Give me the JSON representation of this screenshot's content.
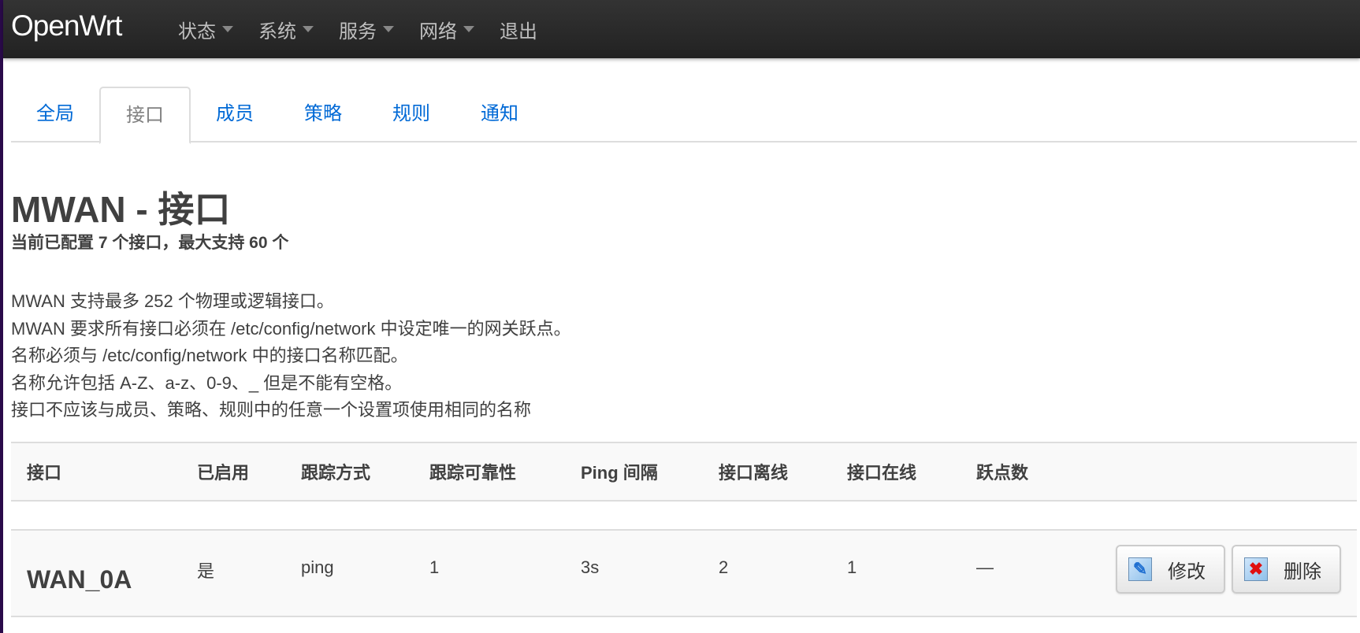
{
  "navbar": {
    "brand": "OpenWrt",
    "items": [
      {
        "label": "状态",
        "dropdown": true
      },
      {
        "label": "系统",
        "dropdown": true
      },
      {
        "label": "服务",
        "dropdown": true
      },
      {
        "label": "网络",
        "dropdown": true
      },
      {
        "label": "退出",
        "dropdown": false
      }
    ]
  },
  "tabs": [
    {
      "label": "全局"
    },
    {
      "label": "接口",
      "active": true
    },
    {
      "label": "成员"
    },
    {
      "label": "策略"
    },
    {
      "label": "规则"
    },
    {
      "label": "通知"
    }
  ],
  "page": {
    "title": "MWAN - 接口",
    "subtitle": "当前已配置 7 个接口，最大支持 60 个",
    "description": [
      "MWAN 支持最多 252 个物理或逻辑接口。",
      "MWAN 要求所有接口必须在 /etc/config/network 中设定唯一的网关跃点。",
      "名称必须与 /etc/config/network 中的接口名称匹配。",
      "名称允许包括 A-Z、a-z、0-9、_ 但是不能有空格。",
      "接口不应该与成员、策略、规则中的任意一个设置项使用相同的名称"
    ]
  },
  "table": {
    "headers": [
      "接口",
      "已启用",
      "跟踪方式",
      "跟踪可靠性",
      "Ping 间隔",
      "接口离线",
      "接口在线",
      "跃点数"
    ],
    "rows": [
      {
        "name": "WAN_0A",
        "enabled": "是",
        "track_method": "ping",
        "reliability": "1",
        "ping_interval": "3s",
        "down": "2",
        "up": "1",
        "metric": "—",
        "edit_label": "修改",
        "delete_label": "删除"
      }
    ]
  }
}
